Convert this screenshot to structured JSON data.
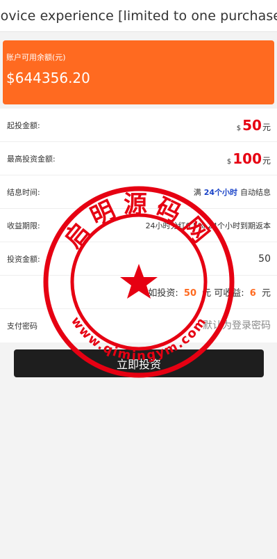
{
  "header": {
    "title": "Novice experience [limited to one purchase]"
  },
  "balance": {
    "label": "账户可用余额(元)",
    "value": "$644356.20"
  },
  "rows": {
    "min_invest": {
      "label": "起投金额:",
      "currency": "$",
      "amount": "50",
      "unit": "元"
    },
    "max_invest": {
      "label": "最高投资金额:",
      "currency": "$",
      "amount": "100",
      "unit": "元"
    },
    "settle_time": {
      "label": "结息时间:",
      "prefix": "满",
      "highlight": "24个小时",
      "suffix": "自动结息"
    },
    "income_period": {
      "label": "收益期限:",
      "value": "24小时分红0.5% 24个小时到期返本"
    },
    "invest_amount": {
      "label": "投资金额:",
      "value": "50"
    },
    "calc": {
      "prefix": "如投资:",
      "invest": "50",
      "mid": "元 可收益:",
      "income": "6",
      "unit": "元"
    },
    "pay_password": {
      "label": "支付密码",
      "placeholder": "默认为登录密码"
    }
  },
  "submit": {
    "label": "立即投资"
  },
  "watermark": {
    "top_text": "启明源码网",
    "bottom_text": "www.qimingym.com"
  },
  "colors": {
    "accent": "#ff6a20",
    "highlight": "#e60012",
    "link": "#1a44c8",
    "button": "#1e1e1e",
    "stamp": "#e60012"
  }
}
